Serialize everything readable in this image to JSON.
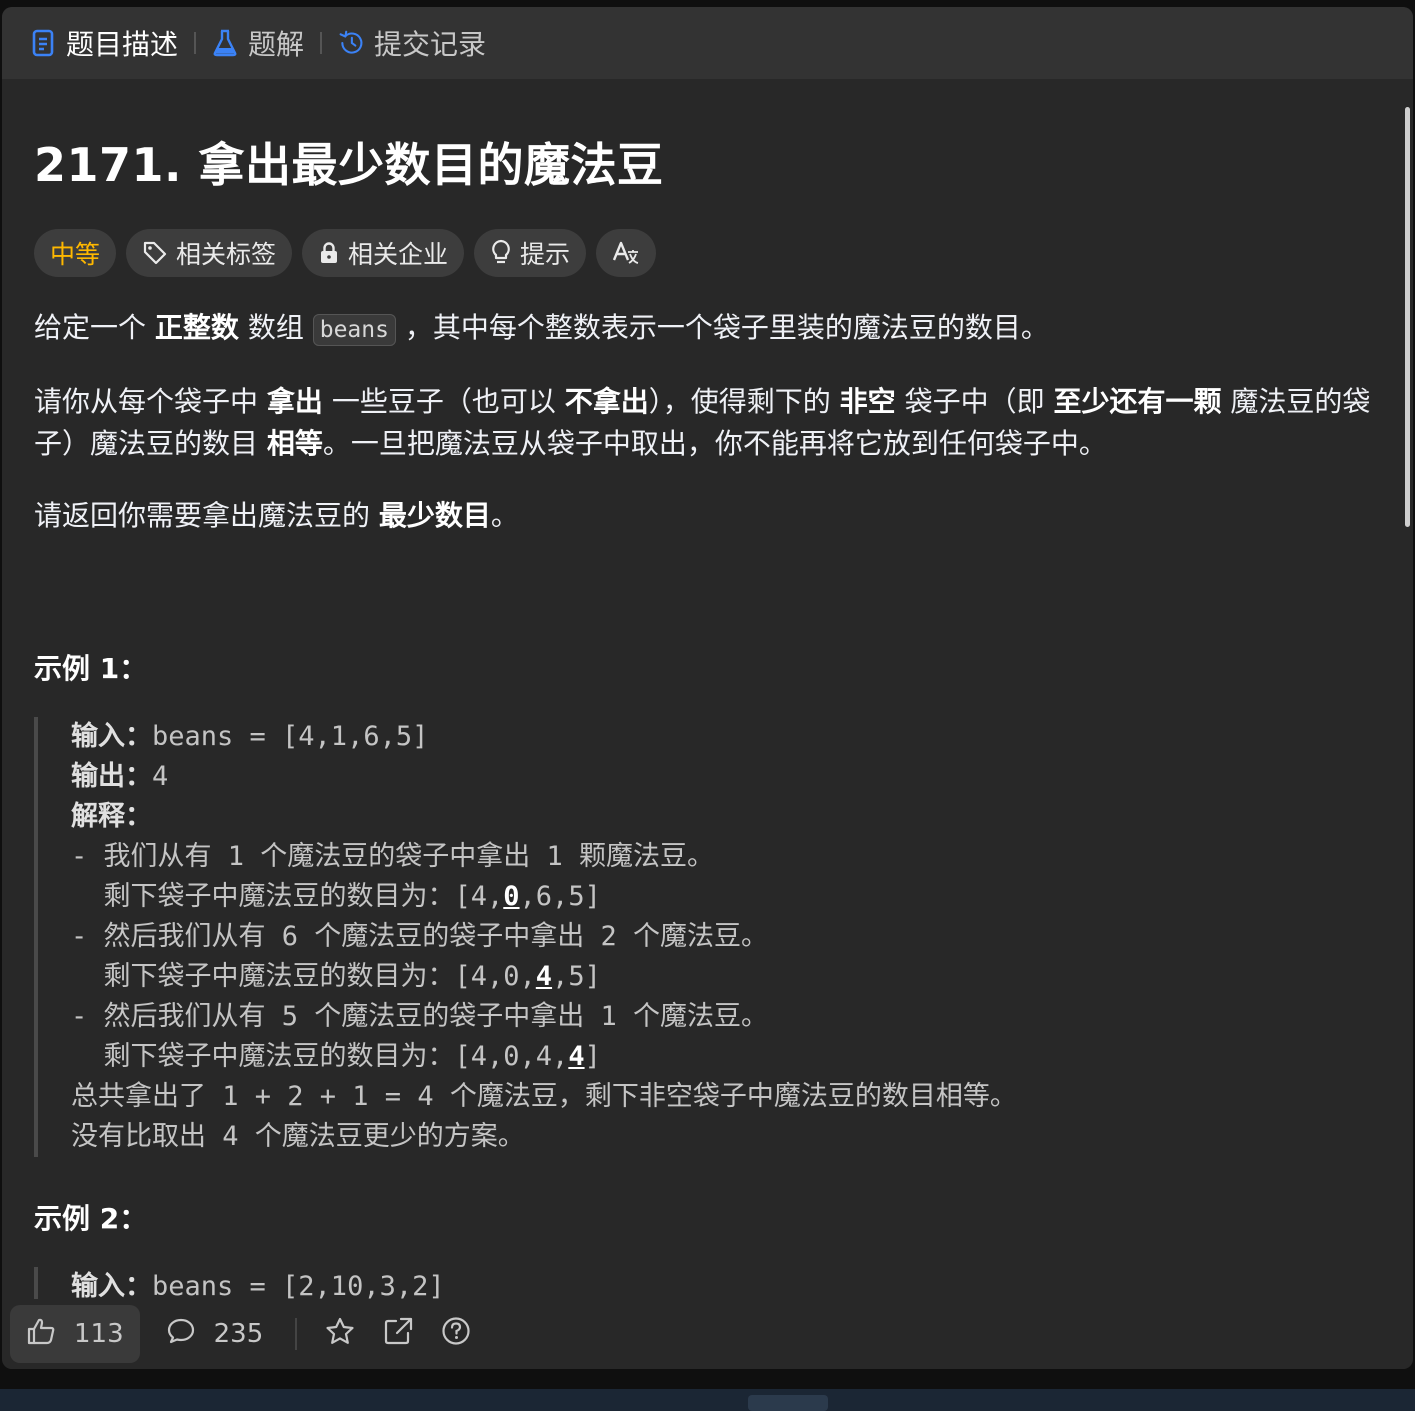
{
  "tabs": [
    {
      "label": "题目描述",
      "icon": "description-icon",
      "active": true
    },
    {
      "label": "题解",
      "icon": "flask-icon",
      "active": false
    },
    {
      "label": "提交记录",
      "icon": "history-icon",
      "active": false
    }
  ],
  "problem": {
    "title": "2171. 拿出最少数目的魔法豆",
    "difficulty": "中等",
    "badges": {
      "tags": "相关标签",
      "companies": "相关企业",
      "hint": "提示"
    }
  },
  "description": {
    "p1": {
      "a": "给定一个 ",
      "b1": "正整数",
      "c": " 数组 ",
      "code": "beans",
      "d": " ，其中每个整数表示一个袋子里装的魔法豆的数目。"
    },
    "p2": {
      "a": "请你从每个袋子中 ",
      "b1": "拿出",
      "c": " 一些豆子（也可以 ",
      "b2": "不拿出",
      "d": "），使得剩下的 ",
      "b3": "非空",
      "e": " 袋子中（即 ",
      "b4": "至少还有一颗",
      "f": " 魔法豆的袋子）魔法豆的数目 ",
      "b5": "相等",
      "g": "。一旦把魔法豆从袋子中取出，你不能再将它放到任何袋子中。"
    },
    "p3": {
      "a": "请返回你需要拿出魔法豆的 ",
      "b1": "最少数目",
      "c": "。"
    }
  },
  "example1": {
    "title": "示例 1：",
    "input_label": "输入：",
    "input_value": "beans = [4,1,6,5]",
    "output_label": "输出：",
    "output_value": "4",
    "explain_label": "解释：",
    "l1": "- 我们从有 1 个魔法豆的袋子中拿出 1 颗魔法豆。",
    "l2a": "  剩下袋子中魔法豆的数目为：[4,",
    "l2b": "0",
    "l2c": ",6,5]",
    "l3": "- 然后我们从有 6 个魔法豆的袋子中拿出 2 个魔法豆。",
    "l4a": "  剩下袋子中魔法豆的数目为：[4,0,",
    "l4b": "4",
    "l4c": ",5]",
    "l5": "- 然后我们从有 5 个魔法豆的袋子中拿出 1 个魔法豆。",
    "l6a": "  剩下袋子中魔法豆的数目为：[4,0,4,",
    "l6b": "4",
    "l6c": "]",
    "l7": "总共拿出了 1 + 2 + 1 = 4 个魔法豆，剩下非空袋子中魔法豆的数目相等。",
    "l8": "没有比取出 4 个魔法豆更少的方案。"
  },
  "example2": {
    "title": "示例 2：",
    "input_label": "输入：",
    "input_value": "beans = [2,10,3,2]"
  },
  "bottom": {
    "likes": "113",
    "comments": "235"
  },
  "colors": {
    "accent_blue": "#3b82f6",
    "difficulty": "#ffb800",
    "background": "#282828"
  }
}
